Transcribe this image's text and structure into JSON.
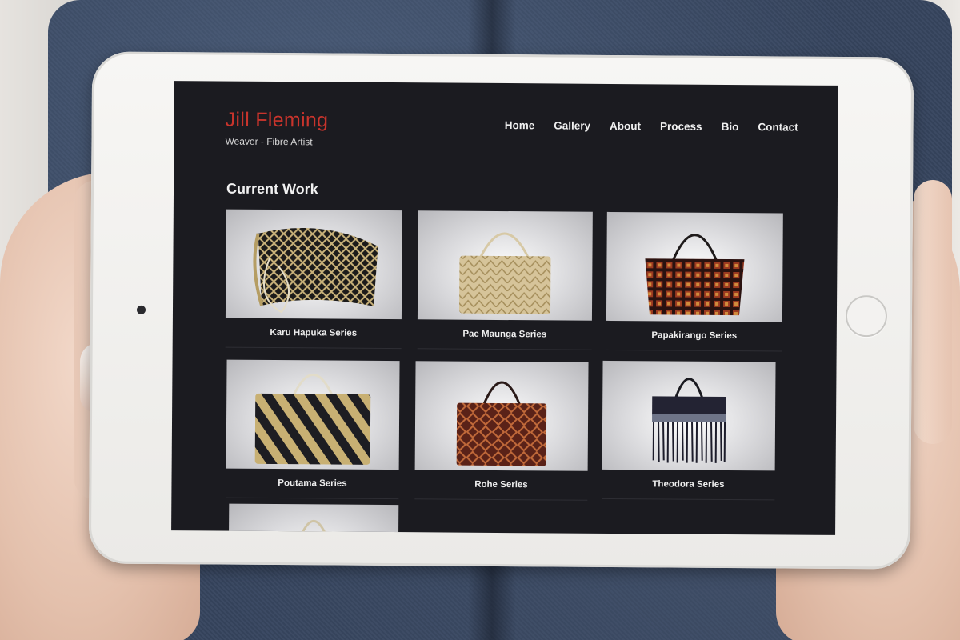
{
  "brand": {
    "name": "Jill Fleming",
    "tagline": "Weaver - Fibre Artist",
    "accent_color": "#c8342c"
  },
  "nav": {
    "items": [
      {
        "label": "Home"
      },
      {
        "label": "Gallery"
      },
      {
        "label": "About"
      },
      {
        "label": "Process"
      },
      {
        "label": "Bio"
      },
      {
        "label": "Contact"
      }
    ]
  },
  "main": {
    "section_title": "Current Work",
    "gallery": [
      {
        "caption": "Karu Hapuka Series",
        "bag_style": "clutch-black-gold"
      },
      {
        "caption": "Pae Maunga Series",
        "bag_style": "tote-natural"
      },
      {
        "caption": "Papakirango Series",
        "bag_style": "tote-red-black"
      },
      {
        "caption": "Poutama Series",
        "bag_style": "tote-diagonal-gold"
      },
      {
        "caption": "Rohe Series",
        "bag_style": "tote-red-pattern"
      },
      {
        "caption": "Theodora Series",
        "bag_style": "fringe-black"
      },
      {
        "caption": "",
        "bag_style": "partial"
      }
    ]
  },
  "colors": {
    "page_background": "#1b1b20",
    "text": "#f0f0f0"
  }
}
